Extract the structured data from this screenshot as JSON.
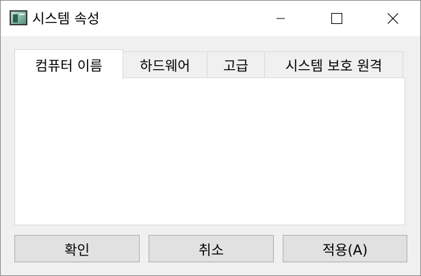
{
  "window": {
    "title": "시스템 속성",
    "controls": {
      "minimize_icon": "minimize-icon",
      "maximize_icon": "maximize-icon",
      "close_icon": "close-icon"
    }
  },
  "tabs": [
    {
      "label": "컴퓨터 이름",
      "selected": true
    },
    {
      "label": "하드웨어",
      "selected": false
    },
    {
      "label": "고급",
      "selected": false
    },
    {
      "label": "시스템 보호 원격",
      "selected": false
    }
  ],
  "buttons": {
    "ok": "확인",
    "cancel": "취소",
    "apply": "적용(A)"
  },
  "colors": {
    "window_bg": "#f0f0f0",
    "titlebar_bg": "#ffffff",
    "button_bg": "#e1e1e1",
    "button_border": "#adadad"
  }
}
